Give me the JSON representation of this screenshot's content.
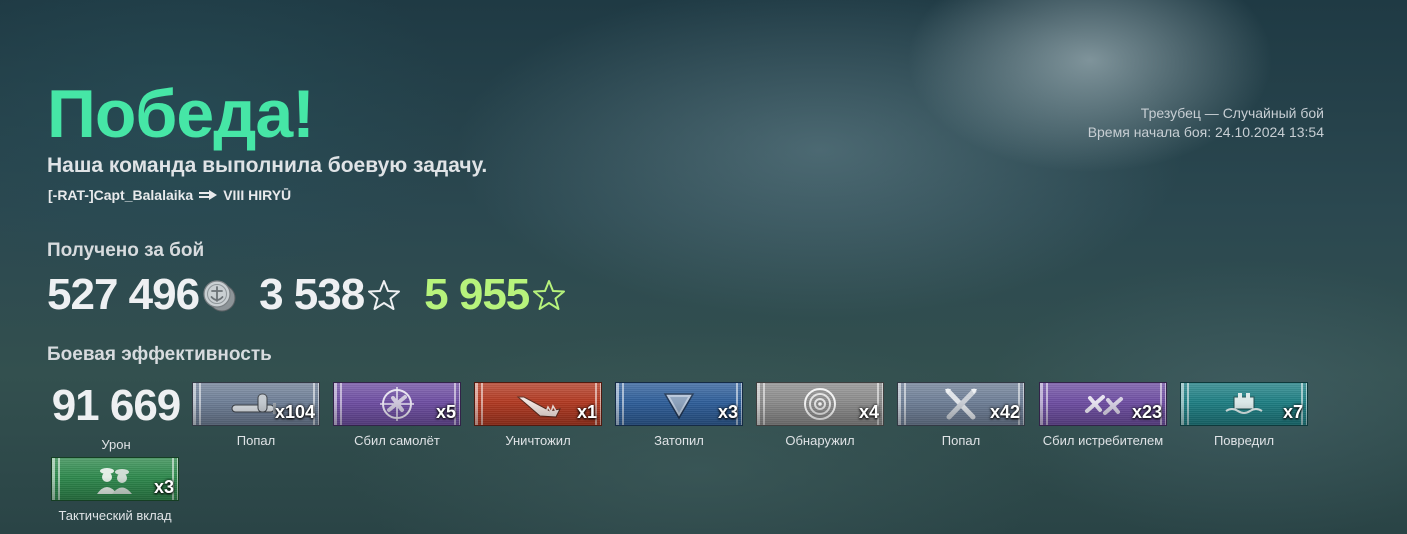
{
  "result": {
    "title": "Победа!",
    "subtitle": "Наша команда выполнила боевую задачу.",
    "player": "[-RAT-]Capt_Balalaika",
    "ship": "VIII HIRYŪ"
  },
  "battle_info": {
    "map_mode": "Трезубец — Случайный бой",
    "start_time": "Время начала боя: 24.10.2024 13:54"
  },
  "earned": {
    "label": "Получено за бой",
    "credits": "527 496",
    "credits_icon": "credits-coin-icon",
    "xp": "3 538",
    "xp_icon": "star-outline-icon",
    "free_xp": "5 955",
    "free_xp_icon": "star-outline-icon",
    "free_xp_color": "#b7f37c"
  },
  "efficiency": {
    "label": "Боевая эффективность",
    "damage_value": "91 669",
    "damage_label": "Урон",
    "ribbons": [
      {
        "label": "Попал",
        "count": "x104",
        "color": "#6f7f97",
        "icon": "torpedo-hit-icon"
      },
      {
        "label": "Сбил самолёт",
        "count": "x5",
        "color": "#6f4fa3",
        "icon": "plane-crosshair-icon"
      },
      {
        "label": "Уничтожил",
        "count": "x1",
        "color": "#b23a22",
        "icon": "sinking-ship-icon"
      },
      {
        "label": "Затопил",
        "count": "x3",
        "color": "#2f5f9a",
        "icon": "flood-triangle-icon"
      },
      {
        "label": "Обнаружил",
        "count": "x4",
        "color": "#8c8c8c",
        "icon": "radar-rings-icon"
      },
      {
        "label": "Попал",
        "count": "x42",
        "color": "#6f7f97",
        "icon": "crossed-bombs-icon"
      },
      {
        "label": "Сбил истребителем",
        "count": "x23",
        "color": "#6f4fa3",
        "icon": "fighter-planes-icon"
      },
      {
        "label": "Повредил",
        "count": "x7",
        "color": "#1f7f84",
        "icon": "damaged-ship-icon"
      },
      {
        "label": "Тактический вклад",
        "count": "x3",
        "color": "#2f8a4e",
        "icon": "officers-icon"
      }
    ]
  }
}
